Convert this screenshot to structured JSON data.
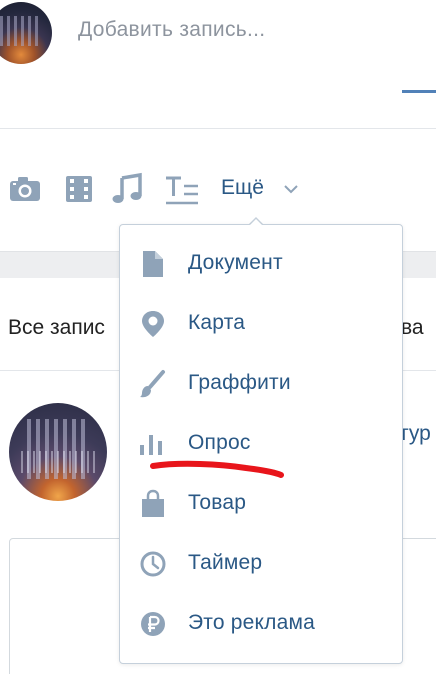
{
  "composer": {
    "placeholder": "Добавить запись..."
  },
  "toolbar": {
    "icons": [
      "camera-icon",
      "video-icon",
      "music-icon",
      "text-format-icon"
    ],
    "more_label": "Ещё",
    "more_icon": "chevron-down-icon"
  },
  "tabs": {
    "all_posts_fragment": "Все запис",
    "right_tab_fragment": "ва"
  },
  "post": {
    "author_fragment": "тур"
  },
  "dropdown": {
    "items": [
      {
        "label": "Документ",
        "icon": "document-icon"
      },
      {
        "label": "Карта",
        "icon": "map-pin-icon"
      },
      {
        "label": "Граффити",
        "icon": "brush-icon"
      },
      {
        "label": "Опрос",
        "icon": "poll-icon"
      },
      {
        "label": "Товар",
        "icon": "shopping-bag-icon"
      },
      {
        "label": "Таймер",
        "icon": "clock-icon"
      },
      {
        "label": "Это реклама",
        "icon": "ruble-icon"
      }
    ]
  },
  "colors": {
    "link": "#2a5885",
    "icon": "#8fa3b8",
    "accent": "#5181b8",
    "annotation": "#e8151b",
    "placeholder": "#8d949e"
  }
}
